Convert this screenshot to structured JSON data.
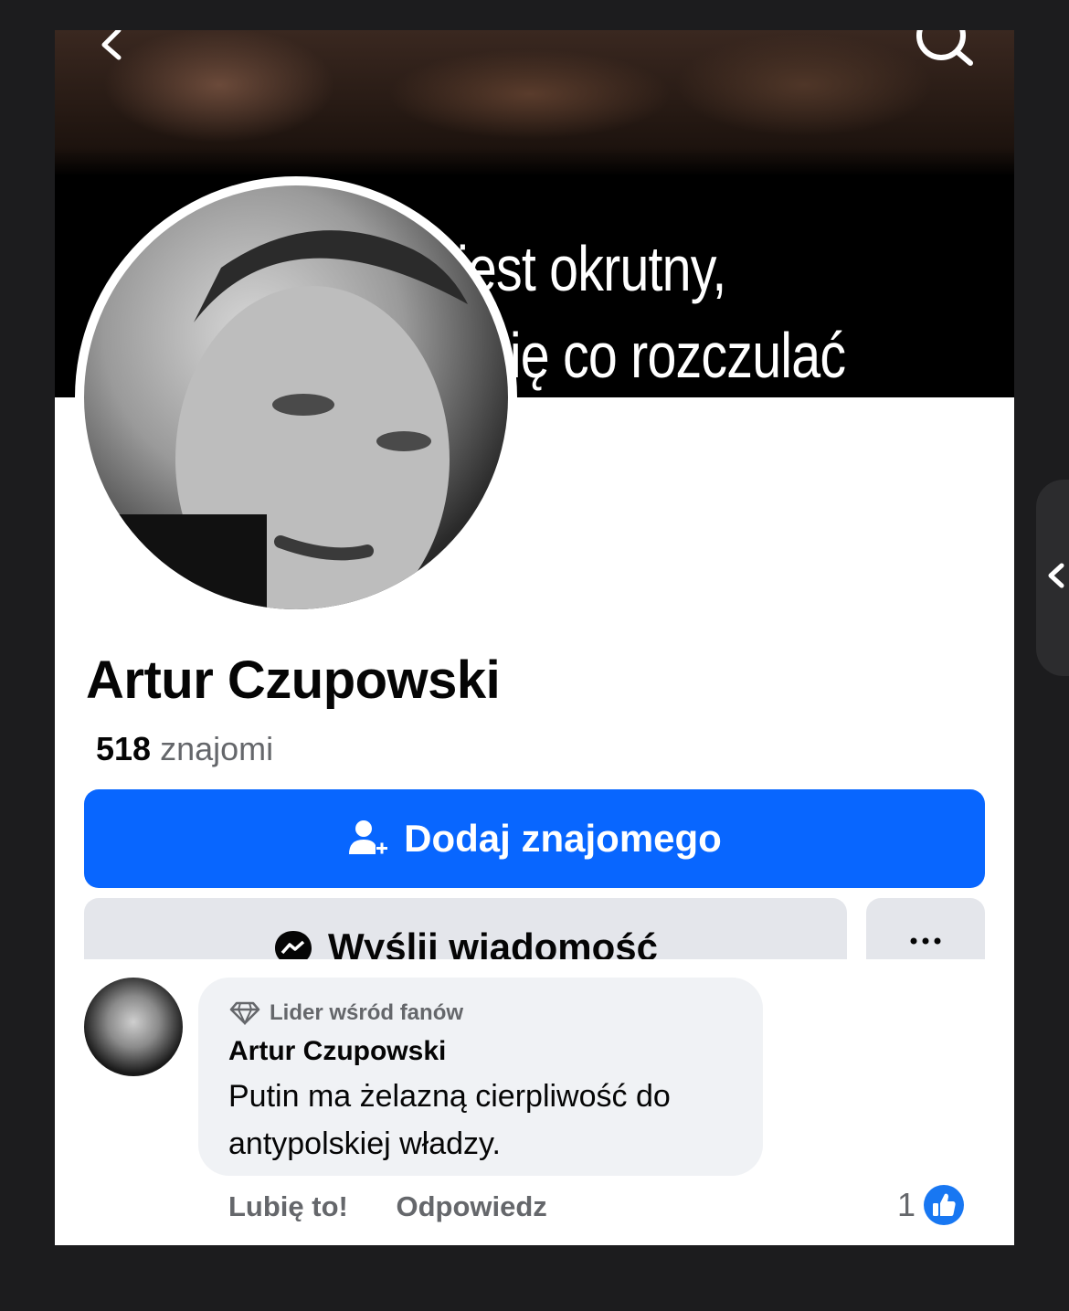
{
  "cover": {
    "line1": "jest okrutny,",
    "line2": "się co rozczulać"
  },
  "profile": {
    "name": "Artur Czupowski",
    "friends_count": "518",
    "friends_label": "znajomi"
  },
  "buttons": {
    "add_friend": "Dodaj znajomego",
    "send_message": "Wyślij wiadomość",
    "more": "···"
  },
  "comment": {
    "badge": "Lider wśród fanów",
    "author": "Artur Czupowski",
    "text": "Putin ma żelazną cierpliwość do antypolskiej władzy.",
    "like_action": "Lubię to!",
    "reply_action": "Odpowiedz",
    "reaction_count": "1"
  },
  "colors": {
    "primary": "#0866ff",
    "secondary_button": "#e4e6eb",
    "bubble": "#f0f2f5",
    "muted_text": "#65676b"
  },
  "icons": [
    "back-icon",
    "search-icon",
    "add-friend-icon",
    "messenger-icon",
    "diamond-icon",
    "like-icon",
    "chevron-left-icon"
  ]
}
